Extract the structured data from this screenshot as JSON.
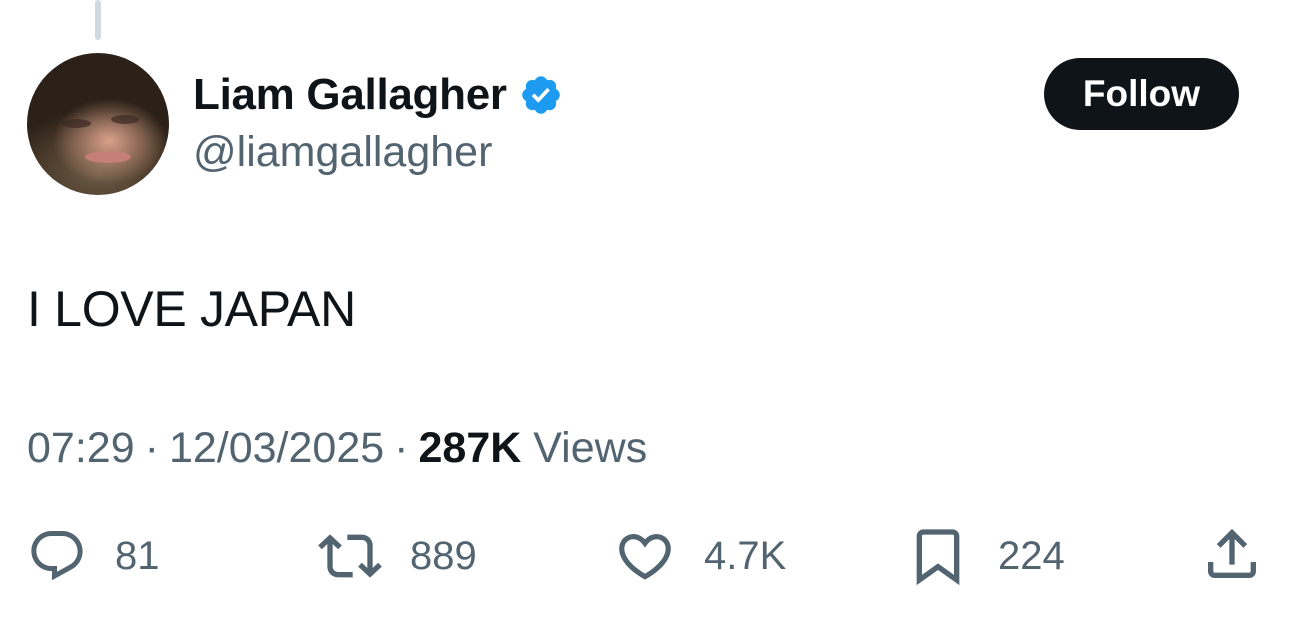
{
  "tweet": {
    "author": {
      "display_name": "Liam Gallagher",
      "handle": "@liamgallagher",
      "verified_icon": "verified-badge-icon",
      "avatar": "profile-photo"
    },
    "follow_label": "Follow",
    "text": "I LOVE JAPAN",
    "meta": {
      "time": "07:29",
      "separator": "·",
      "date": "12/03/2025",
      "views_count": "287K",
      "views_label": "Views"
    },
    "actions": {
      "replies": "81",
      "reposts": "889",
      "likes": "4.7K",
      "bookmarks": "224"
    }
  },
  "colors": {
    "text": "#0f1419",
    "secondary": "#536471",
    "verified": "#1d9bf0",
    "button_bg": "#0f1419",
    "thread_line": "#cfd9de"
  }
}
